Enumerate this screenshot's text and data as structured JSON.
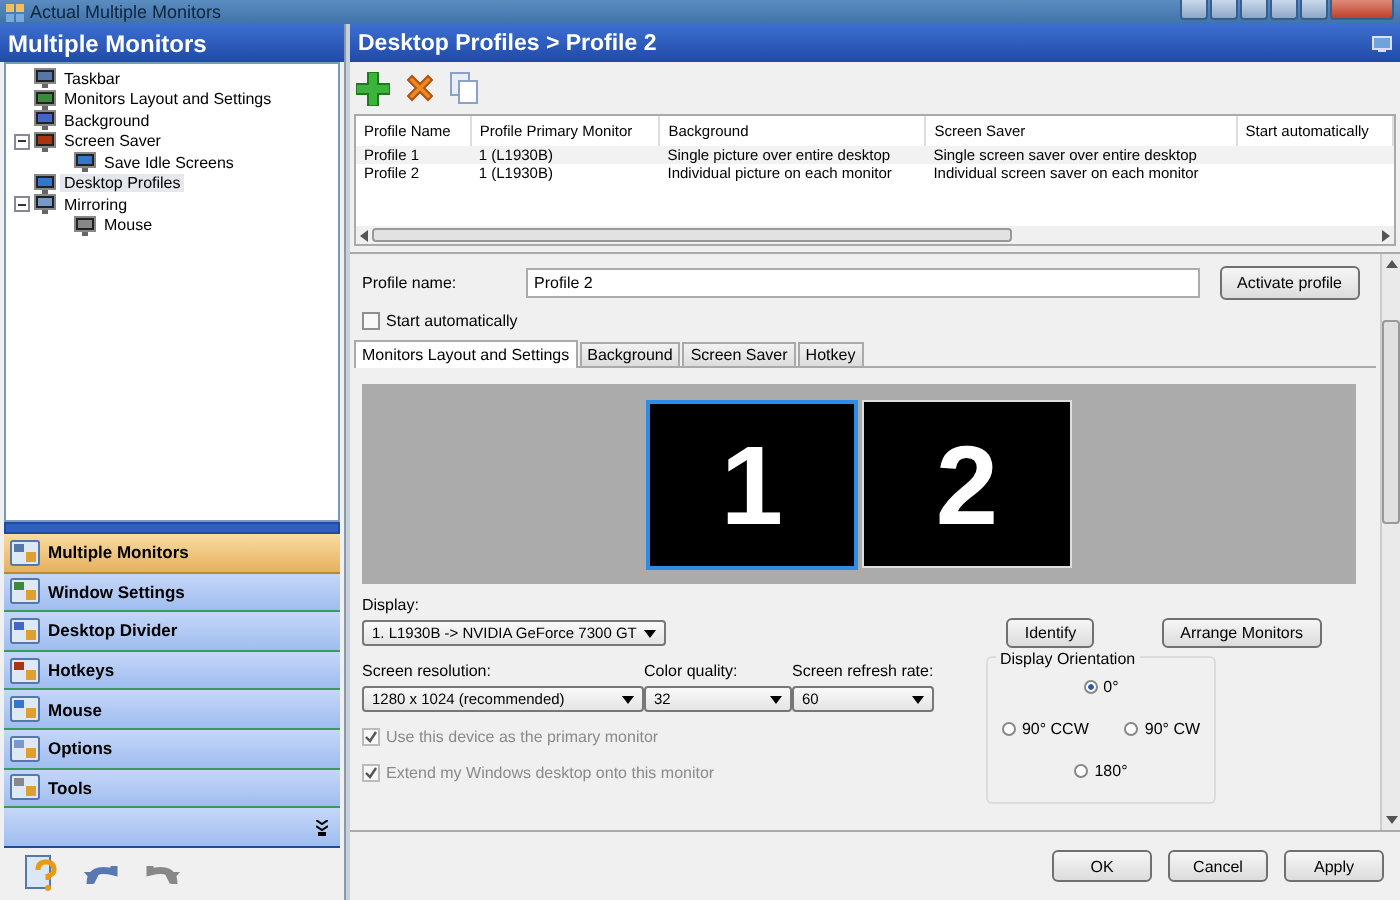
{
  "window": {
    "title": "Actual Multiple Monitors"
  },
  "sidebar": {
    "title": "Multiple Monitors",
    "tree": [
      {
        "label": "Taskbar",
        "selected": false
      },
      {
        "label": "Monitors Layout and Settings",
        "selected": false
      },
      {
        "label": "Background",
        "selected": false
      },
      {
        "label": "Screen Saver",
        "selected": false,
        "expanded": true,
        "children": [
          {
            "label": "Save Idle Screens",
            "selected": false
          }
        ]
      },
      {
        "label": "Desktop Profiles",
        "selected": true
      },
      {
        "label": "Mirroring",
        "selected": false,
        "expanded": true,
        "children": [
          {
            "label": "Mouse",
            "selected": false
          }
        ]
      }
    ],
    "nav": [
      {
        "label": "Multiple Monitors",
        "selected": true
      },
      {
        "label": "Window Settings",
        "selected": false
      },
      {
        "label": "Desktop Divider",
        "selected": false
      },
      {
        "label": "Hotkeys",
        "selected": false
      },
      {
        "label": "Mouse",
        "selected": false
      },
      {
        "label": "Options",
        "selected": false
      },
      {
        "label": "Tools",
        "selected": false
      }
    ]
  },
  "main": {
    "title": "Desktop Profiles > Profile 2",
    "table": {
      "columns": [
        "Profile Name",
        "Profile Primary Monitor",
        "Background",
        "Screen Saver",
        "Start automatically"
      ],
      "rows": [
        [
          "Profile 1",
          "1 (L1930B)",
          "Single picture over entire desktop",
          "Single screen saver over entire desktop",
          ""
        ],
        [
          "Profile 2",
          "1 (L1930B)",
          "Individual picture on each monitor",
          "Individual screen saver on each monitor",
          ""
        ]
      ]
    },
    "form": {
      "profile_name_label": "Profile name:",
      "profile_name": "Profile 2",
      "activate_button": "Activate profile",
      "start_automatically": {
        "label": "Start automatically",
        "checked": false
      },
      "tabs": [
        {
          "label": "Monitors Layout and Settings",
          "selected": true
        },
        {
          "label": "Background",
          "selected": false
        },
        {
          "label": "Screen Saver",
          "selected": false
        },
        {
          "label": "Hotkey",
          "selected": false
        }
      ],
      "monitors": [
        {
          "label": "1",
          "selected": true
        },
        {
          "label": "2",
          "selected": false
        }
      ],
      "display_label": "Display:",
      "display": "1. L1930B -> NVIDIA GeForce 7300 GT",
      "identify_button": "Identify",
      "arrange_button": "Arrange Monitors",
      "resolution_label": "Screen resolution:",
      "resolution": "1280 x 1024 (recommended)",
      "color_label": "Color quality:",
      "color_quality": "32",
      "refresh_label": "Screen refresh rate:",
      "refresh": "60",
      "checks": [
        {
          "label": "Use this device as the primary monitor",
          "checked": true,
          "disabled": true
        },
        {
          "label": "Extend my Windows desktop onto this monitor",
          "checked": true,
          "disabled": true
        }
      ],
      "orientation": {
        "title": "Display Orientation",
        "options": [
          {
            "label": "0°",
            "selected": true
          },
          {
            "label": "90° CCW",
            "selected": false
          },
          {
            "label": "90° CW",
            "selected": false
          },
          {
            "label": "180°",
            "selected": false
          }
        ]
      }
    }
  },
  "buttons": [
    "OK",
    "Cancel",
    "Apply"
  ]
}
